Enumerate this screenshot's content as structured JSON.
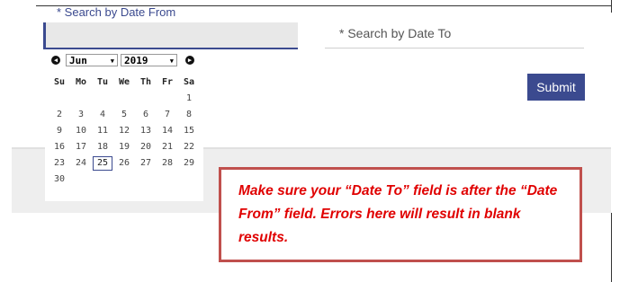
{
  "date_from": {
    "label": "* Search by Date From",
    "value": ""
  },
  "date_to": {
    "placeholder": "* Search by Date To"
  },
  "submit_label": "Submit",
  "calendar": {
    "month": "Jun",
    "year": "2019",
    "weekdays": [
      "Su",
      "Mo",
      "Tu",
      "We",
      "Th",
      "Fr",
      "Sa"
    ],
    "days": [
      "1",
      "2",
      "3",
      "4",
      "5",
      "6",
      "7",
      "8",
      "9",
      "10",
      "11",
      "12",
      "13",
      "14",
      "15",
      "16",
      "17",
      "18",
      "19",
      "20",
      "21",
      "22",
      "23",
      "24",
      "25",
      "26",
      "27",
      "28",
      "29",
      "30"
    ],
    "selected_day": "25"
  },
  "callout": {
    "text": "Make sure your “Date To” field is after the “Date From” field. Errors here will result in blank results."
  },
  "colors": {
    "accent": "#3b4a8f",
    "callout_border": "#c0504d",
    "callout_text": "#e00000"
  }
}
